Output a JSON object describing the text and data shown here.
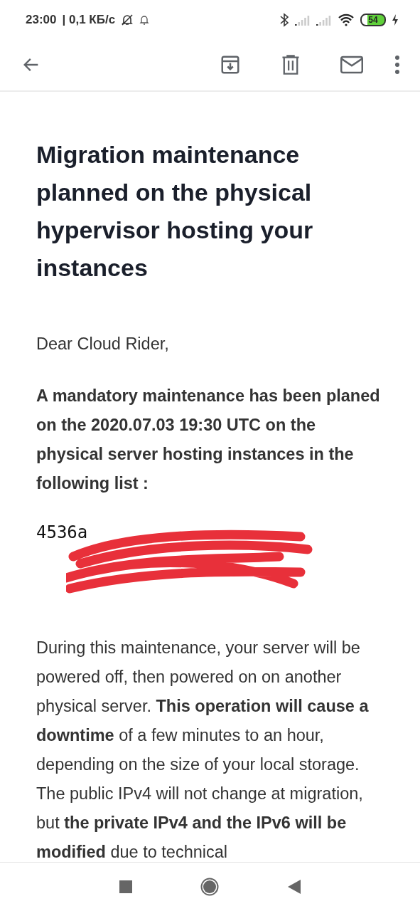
{
  "status_bar": {
    "time": "23:00",
    "speed": "| 0,1 КБ/с",
    "battery": "54"
  },
  "email": {
    "title": "Migration maintenance planned on the physical hypervisor hosting your instances",
    "greeting": "Dear Cloud Rider,",
    "notice": "A mandatory maintenance has been planed on the 2020.07.03 19:30 UTC on the physical server hosting instances in the following list :",
    "instance_list_visible": "4536a",
    "redacted": true,
    "body": "During this maintenance, your server will be powered off, then powered on on another physical server. **This operation will cause a downtime** of a few minutes to an hour, depending on the size of your local storage. The public IPv4 will not change at migration, but **the private IPv4 and the IPv6 will be modified** due to technical"
  }
}
